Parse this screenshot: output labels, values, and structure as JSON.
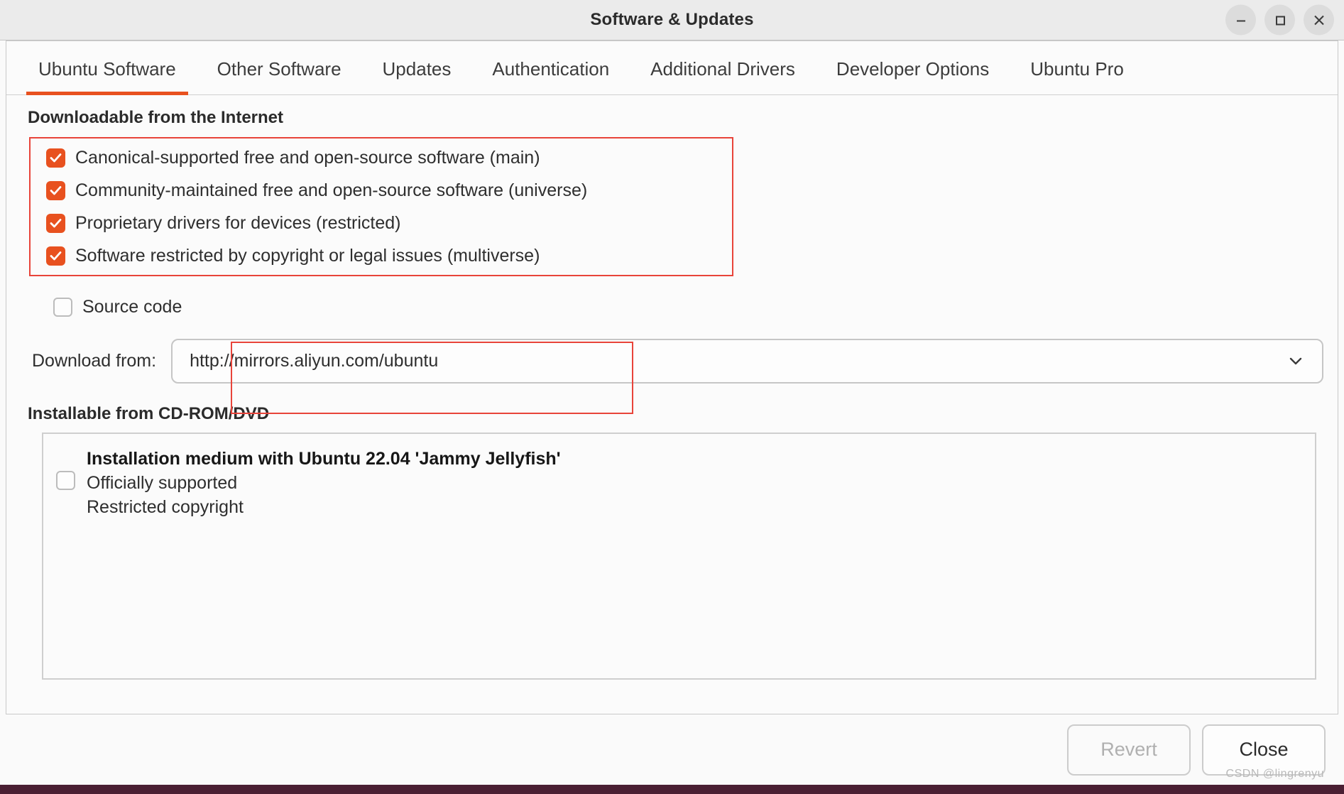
{
  "window": {
    "title": "Software & Updates",
    "controls": [
      {
        "name": "minimize",
        "glyph": "minimize-icon"
      },
      {
        "name": "maximize",
        "glyph": "maximize-icon"
      },
      {
        "name": "close",
        "glyph": "close-icon"
      }
    ]
  },
  "tabs": [
    {
      "label": "Ubuntu Software",
      "active": true
    },
    {
      "label": "Other Software",
      "active": false
    },
    {
      "label": "Updates",
      "active": false
    },
    {
      "label": "Authentication",
      "active": false
    },
    {
      "label": "Additional Drivers",
      "active": false
    },
    {
      "label": "Developer Options",
      "active": false
    },
    {
      "label": "Ubuntu Pro",
      "active": false
    }
  ],
  "internet_section": {
    "heading": "Downloadable from the Internet",
    "repositories": [
      {
        "label": "Canonical-supported free and open-source software (main)",
        "checked": true
      },
      {
        "label": "Community-maintained free and open-source software (universe)",
        "checked": true
      },
      {
        "label": "Proprietary drivers for devices (restricted)",
        "checked": true
      },
      {
        "label": "Software restricted by copyright or legal issues (multiverse)",
        "checked": true
      }
    ],
    "source_code": {
      "label": "Source code",
      "checked": false
    },
    "download_from": {
      "label": "Download from:",
      "value": "http://mirrors.aliyun.com/ubuntu",
      "chevron": "chevron-down-icon"
    }
  },
  "cdrom_section": {
    "heading": "Installable from CD-ROM/DVD",
    "item": {
      "medium": "Installation medium with Ubuntu 22.04 'Jammy Jellyfish'",
      "lines": [
        "Officially supported",
        "Restricted copyright"
      ],
      "checked": false
    }
  },
  "footer": {
    "revert_label": "Revert",
    "close_label": "Close",
    "revert_disabled": true
  },
  "watermark": "CSDN @lingrenyu",
  "colors": {
    "accent": "#e8511f",
    "annotation": "#e8443a",
    "titlebar": "#ebebeb",
    "desktop": "#4a1f33"
  }
}
